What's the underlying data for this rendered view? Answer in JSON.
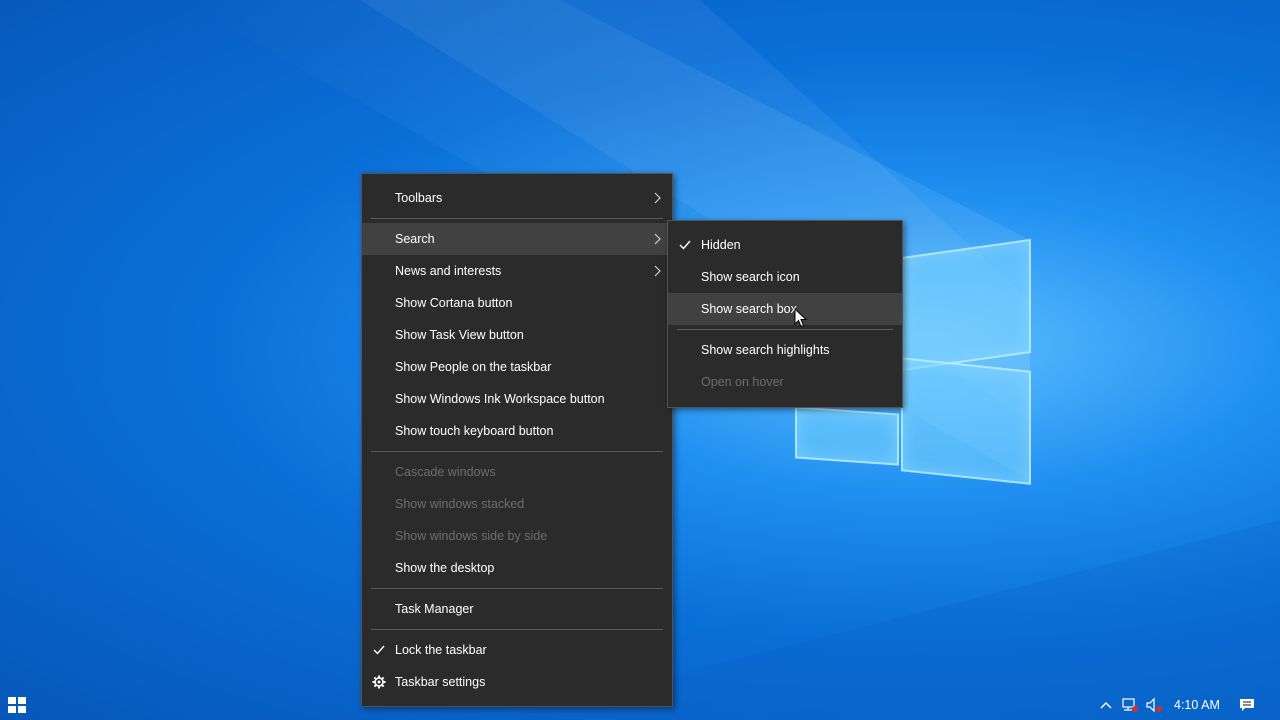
{
  "context_menu": {
    "items": [
      {
        "label": "Toolbars"
      },
      {
        "label": "Search"
      },
      {
        "label": "News and interests"
      },
      {
        "label": "Show Cortana button"
      },
      {
        "label": "Show Task View button"
      },
      {
        "label": "Show People on the taskbar"
      },
      {
        "label": "Show Windows Ink Workspace button"
      },
      {
        "label": "Show touch keyboard button"
      },
      {
        "label": "Cascade windows"
      },
      {
        "label": "Show windows stacked"
      },
      {
        "label": "Show windows side by side"
      },
      {
        "label": "Show the desktop"
      },
      {
        "label": "Task Manager"
      },
      {
        "label": "Lock the taskbar"
      },
      {
        "label": "Taskbar settings"
      }
    ]
  },
  "search_submenu": {
    "items": [
      {
        "label": "Hidden"
      },
      {
        "label": "Show search icon"
      },
      {
        "label": "Show search box"
      },
      {
        "label": "Show search highlights"
      },
      {
        "label": "Open on hover"
      }
    ]
  },
  "taskbar": {
    "clock": "4:10 AM"
  },
  "icons": {
    "start": "windows-start-icon",
    "tray_chevron": "chevron-up-icon",
    "network": "network-icon",
    "volume": "volume-muted-icon",
    "notifications": "action-center-icon",
    "settings": "gear-icon",
    "check": "checkmark-icon",
    "submenu": "chevron-right-icon"
  },
  "colors": {
    "menu_bg": "#2b2b2b",
    "menu_hover": "#414141",
    "menu_text": "#ffffff",
    "menu_disabled": "#6d6d6d",
    "desktop_blue": "#0a6fd8"
  }
}
